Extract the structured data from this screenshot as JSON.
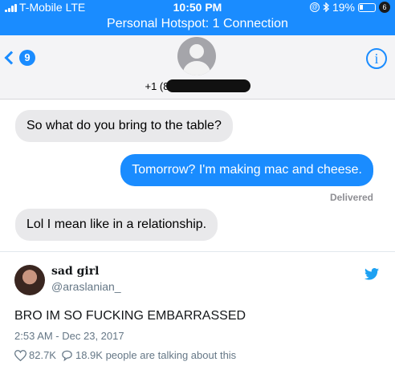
{
  "status_bar": {
    "carrier": "T-Mobile  LTE",
    "time": "10:50 PM",
    "battery": "19%",
    "corner_badge": "6"
  },
  "hotspot": {
    "text": "Personal Hotspot: 1 Connection"
  },
  "header": {
    "back_count": "9",
    "contact": "+1 (8",
    "info_icon": "i"
  },
  "messages": [
    {
      "direction": "in",
      "text": "So what do you bring to the table?"
    },
    {
      "direction": "out",
      "text": "Tomorrow? I'm making mac and cheese."
    },
    {
      "direction": "in",
      "text": "Lol I mean like in a relationship."
    }
  ],
  "delivered_label": "Delivered",
  "tweet": {
    "display_name": "sad girl",
    "handle": "@araslanian_",
    "text": "BRO IM SO FUCKING EMBARRASSED",
    "timestamp": "2:53 AM - Dec 23, 2017",
    "likes": "82.7K",
    "replies_text": "18.9K people are talking about this"
  },
  "colors": {
    "imessage_blue": "#1a8cff",
    "incoming_gray": "#e9e9eb",
    "twitter_blue": "#1da1f2"
  }
}
